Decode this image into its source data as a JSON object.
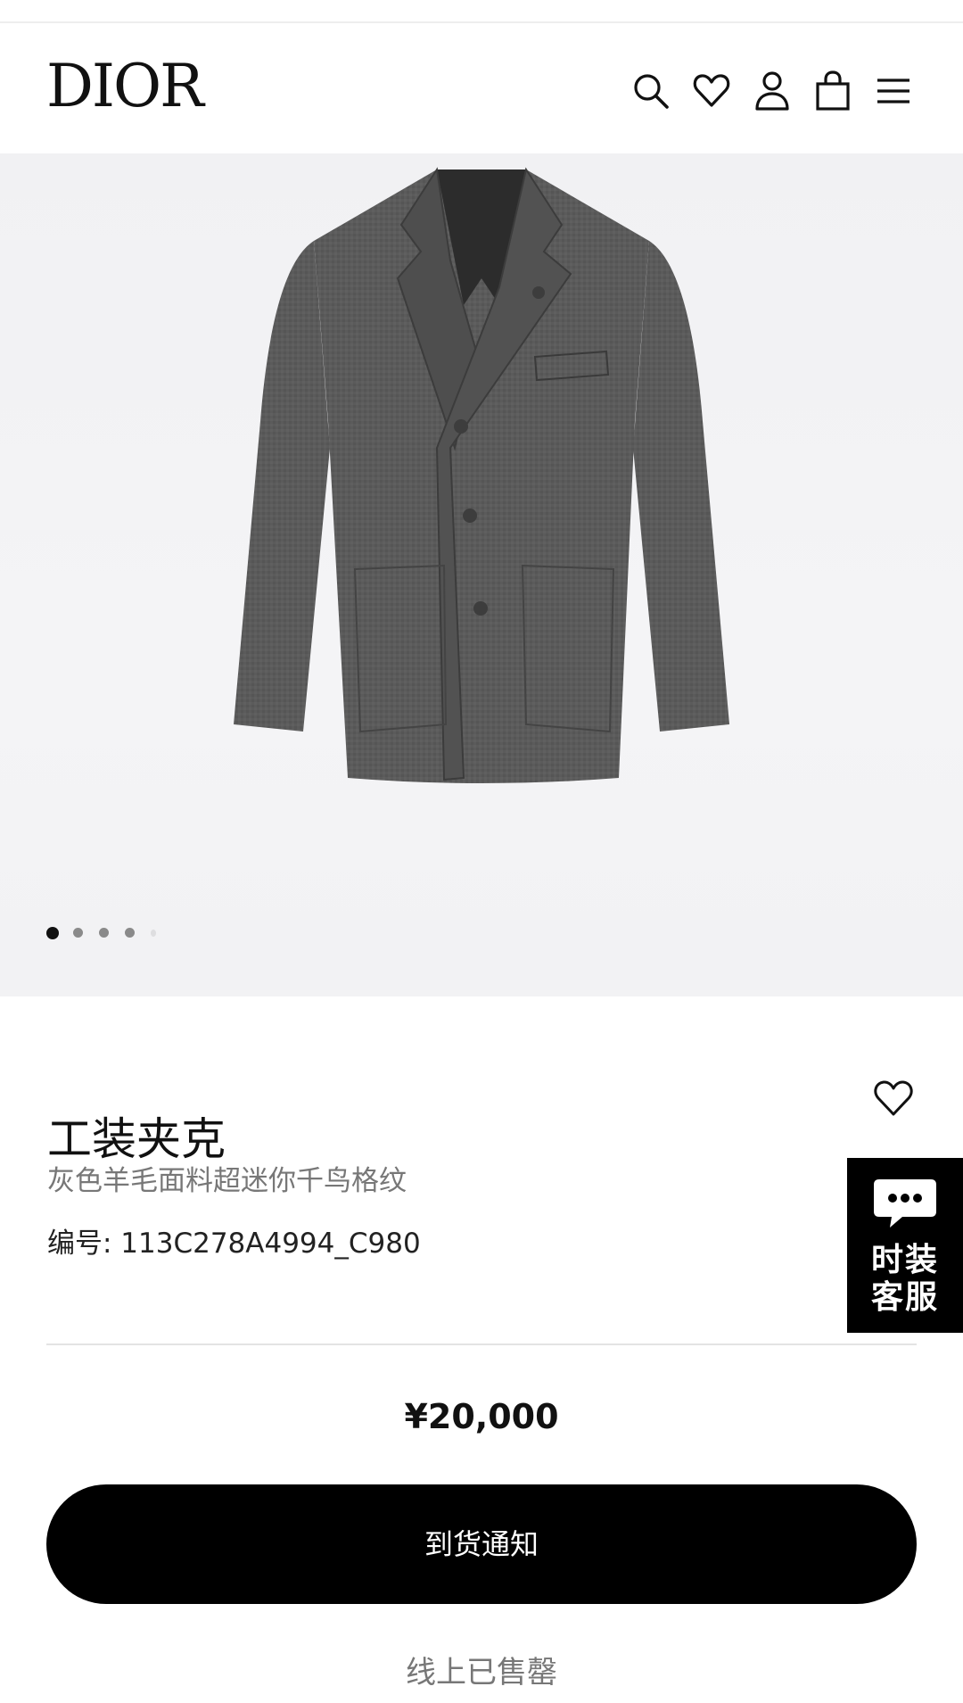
{
  "header": {
    "logo": "DIOR",
    "icons": [
      "search-icon",
      "heart-icon",
      "user-icon",
      "shopping-bag-icon",
      "menu-icon"
    ]
  },
  "gallery": {
    "image": "gray wool work jacket",
    "slide_count": 5,
    "active_index": 0
  },
  "product": {
    "title": "工装夹克",
    "subtitle": "灰色羊毛面料超迷你千鸟格纹",
    "sku": "编号: 113C278A4994_C980",
    "price": "¥20,000"
  },
  "actions": {
    "notify_button": "到货通知",
    "status": "线上已售罄"
  },
  "chat_widget": {
    "label": "时装\n客服"
  },
  "colors": {
    "primary": "#000000",
    "muted_text": "#777777",
    "hero_background": "#f2f2f4"
  }
}
